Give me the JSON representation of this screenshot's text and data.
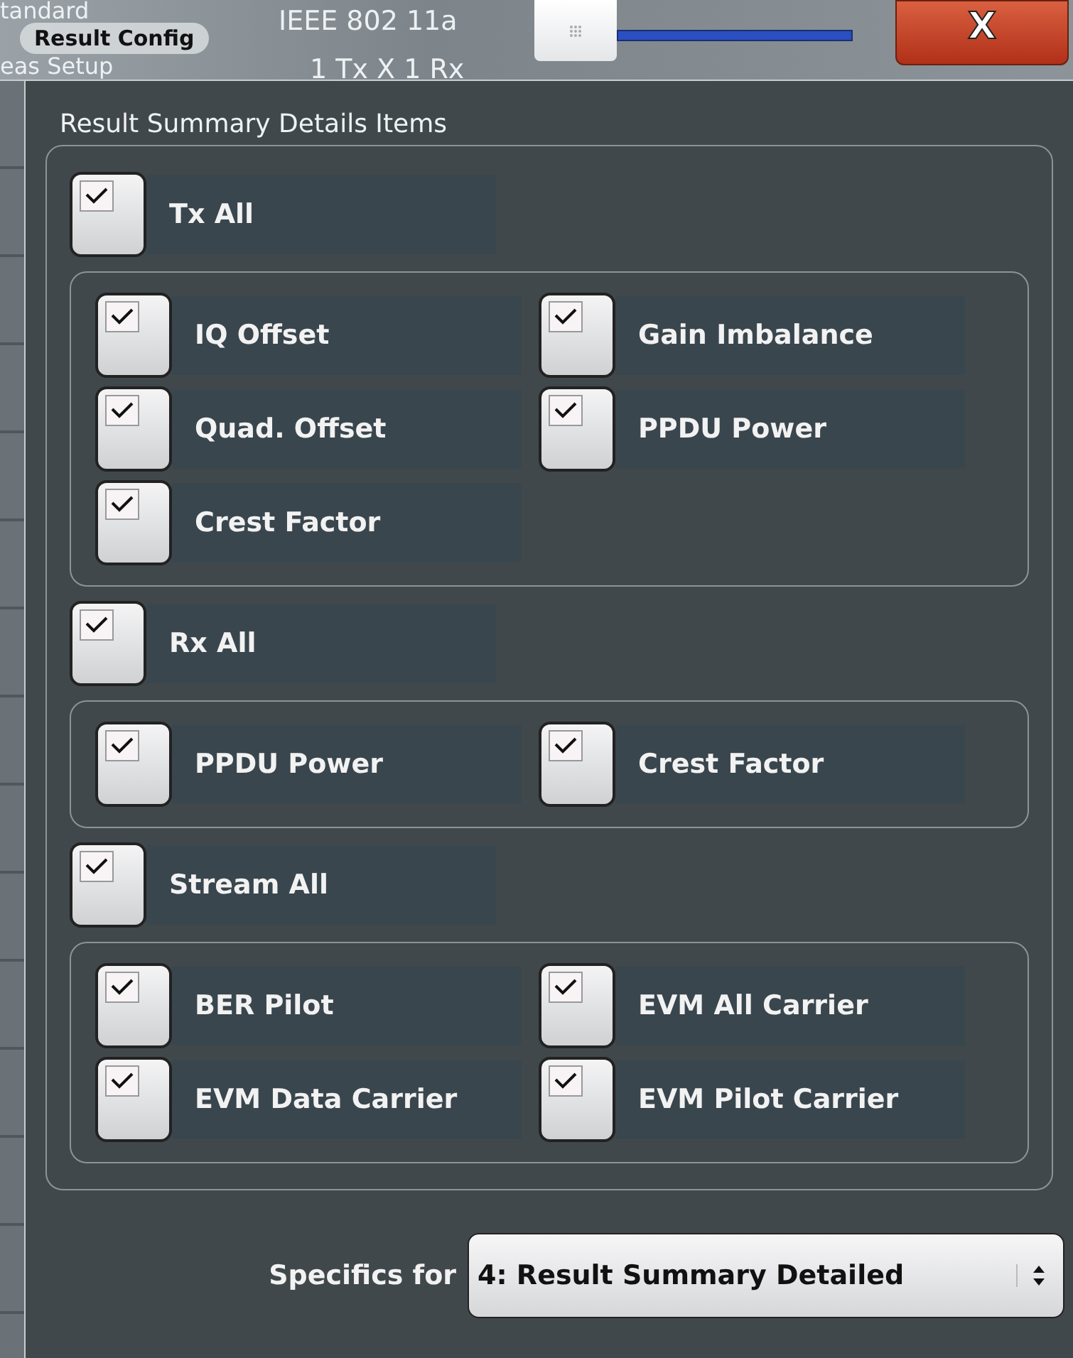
{
  "background": {
    "texts": [
      "tandard",
      "eas Setup",
      "IEEE 802 11a",
      "1 Tx X 1 Rx"
    ]
  },
  "dialog": {
    "title": "Result Config",
    "close": "X"
  },
  "group_title": "Result Summary Details Items",
  "sections": [
    {
      "label": "Tx All",
      "checked": true,
      "items": [
        {
          "label": "IQ Offset",
          "checked": true
        },
        {
          "label": "Gain Imbalance",
          "checked": true
        },
        {
          "label": "Quad. Offset",
          "checked": true
        },
        {
          "label": "PPDU Power",
          "checked": true
        },
        {
          "label": "Crest Factor",
          "checked": true
        }
      ]
    },
    {
      "label": "Rx All",
      "checked": true,
      "items": [
        {
          "label": "PPDU Power",
          "checked": true
        },
        {
          "label": "Crest Factor",
          "checked": true
        }
      ]
    },
    {
      "label": "Stream All",
      "checked": true,
      "items": [
        {
          "label": "BER Pilot",
          "checked": true
        },
        {
          "label": "EVM All Carrier",
          "checked": true
        },
        {
          "label": "EVM Data Carrier",
          "checked": true
        },
        {
          "label": "EVM Pilot Carrier",
          "checked": true
        }
      ]
    }
  ],
  "specifics": {
    "label": "Specifics for",
    "value": "4: Result Summary Detailed"
  }
}
